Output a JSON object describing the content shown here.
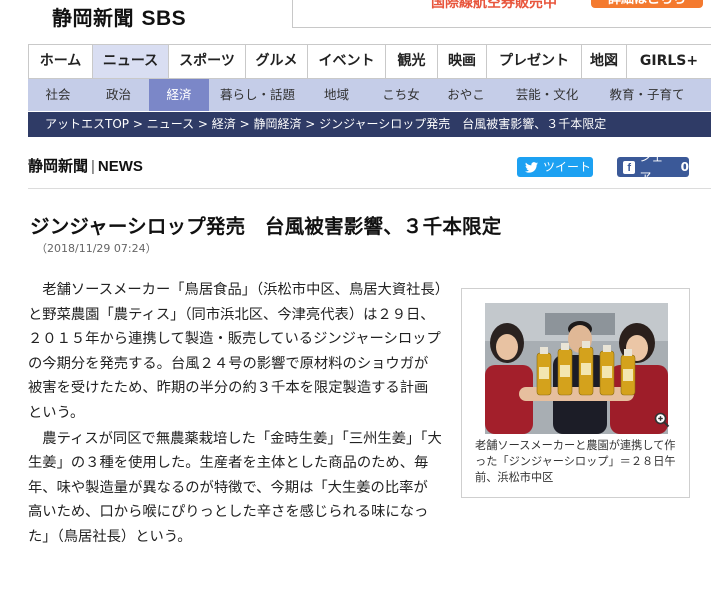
{
  "header": {
    "logo_text": "静岡新聞",
    "logo_sbs": "SBS",
    "promo_text": "国際線航空券販売中",
    "promo_button": "詳細はこちら"
  },
  "main_nav": [
    {
      "label": "ホーム",
      "active": false
    },
    {
      "label": "ニュース",
      "active": true
    },
    {
      "label": "スポーツ",
      "active": false
    },
    {
      "label": "グルメ",
      "active": false
    },
    {
      "label": "イベント",
      "active": false
    },
    {
      "label": "観光",
      "active": false
    },
    {
      "label": "映画",
      "active": false
    },
    {
      "label": "プレゼント",
      "active": false
    },
    {
      "label": "地図",
      "active": false
    },
    {
      "label": "GIRLS+",
      "active": false
    }
  ],
  "sub_nav": [
    {
      "label": "社会",
      "active": false
    },
    {
      "label": "政治",
      "active": false
    },
    {
      "label": "経済",
      "active": true
    },
    {
      "label": "暮らし・話題",
      "active": false
    },
    {
      "label": "地域",
      "active": false
    },
    {
      "label": "こち女",
      "active": false
    },
    {
      "label": "おやこ",
      "active": false
    },
    {
      "label": "芸能・文化",
      "active": false
    },
    {
      "label": "教育・子育て",
      "active": false
    }
  ],
  "breadcrumb": "アットエスTOP > ニュース > 経済 > 静岡経済 > ジンジャーシロップ発売　台風被害影響、３千本限定",
  "news_brand": {
    "name": "静岡新聞",
    "sep": "|",
    "news": "NEWS"
  },
  "share": {
    "tweet_label": "ツイート",
    "share_label": "シェア",
    "share_count": "0"
  },
  "article": {
    "headline": "ジンジャーシロップ発売　台風被害影響、３千本限定",
    "date": "（2018/11/29 07:24）",
    "paragraphs": [
      "老舗ソースメーカー「鳥居食品」（浜松市中区、鳥居大資社長）と野菜農園「農ティス」（同市浜北区、今津亮代表）は２９日、２０１５年から連携して製造・販売しているジンジャーシロップの今期分を発売する。台風２４号の影響で原材料のショウガが被害を受けたため、昨期の半分の約３千本を限定製造する計画という。",
      "農ティスが同区で無農薬栽培した「金時生姜」「三州生姜」「大生姜」の３種を使用した。生産者を主体とした商品のため、毎年、味や製造量が異なるのが特徴で、今期は「大生姜の比率が高いため、口から喉にぴりっとした辛さを感じられる味になった」（鳥居社長）という。"
    ]
  },
  "photo": {
    "caption": "老舗ソースメーカーと農園が連携して作った「ジンジャーシロップ」＝２８日午前、浜松市中区",
    "icon": "zoom-icon"
  },
  "colors": {
    "breadcrumb_bg": "#2f3b66",
    "subnav_bg": "#c5cde8",
    "subnav_active": "#7b87c8",
    "tweet": "#1da1f2",
    "facebook": "#3b5998",
    "promo": "#f47a2f"
  }
}
